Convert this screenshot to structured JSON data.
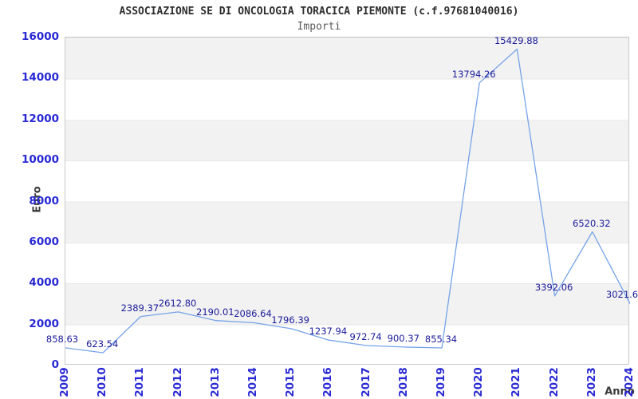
{
  "chart_data": {
    "type": "line",
    "title": "ASSOCIAZIONE SE DI ONCOLOGIA TORACICA PIEMONTE (c.f.97681040016)",
    "subtitle": "Importi",
    "xlabel": "Anno",
    "ylabel": "Euro",
    "ylim": [
      0,
      16000
    ],
    "ytick_step": 2000,
    "grid": "horizontal-bands",
    "legend": null,
    "categories": [
      "2009",
      "2010",
      "2011",
      "2012",
      "2013",
      "2014",
      "2015",
      "2016",
      "2017",
      "2018",
      "2019",
      "2020",
      "2021",
      "2022",
      "2023",
      "2024"
    ],
    "values": [
      858.63,
      623.54,
      2389.37,
      2612.8,
      2190.01,
      2086.64,
      1796.39,
      1237.94,
      972.74,
      900.37,
      855.34,
      13794.26,
      15429.88,
      3392.06,
      6520.32,
      3021.6
    ],
    "point_labels": [
      "858.63",
      "623.54",
      "2389.37",
      "2612.80",
      "2190.01",
      "2086.64",
      "1796.39",
      "1237.94",
      "972.74",
      "900.37",
      "855.34",
      "13794.26",
      "15429.88",
      "3392.06",
      "6520.32",
      "3021.6"
    ],
    "label_dx": [
      -3,
      0,
      0,
      0,
      0,
      0,
      0,
      0,
      0,
      0,
      0,
      -6,
      0,
      0,
      0,
      -9
    ]
  },
  "colors": {
    "line": "#76a3e8",
    "tick_label": "#2929d4",
    "data_label": "#1b1b9a",
    "band_gray": "#f2f2f2",
    "gridline": "#e7e7e7",
    "plot_border": "#c9c9c9",
    "title_text": "#2e2e2e",
    "subtitle_text": "#585858",
    "axis_title_text": "#3a3a3a",
    "background": "#ffffff"
  }
}
